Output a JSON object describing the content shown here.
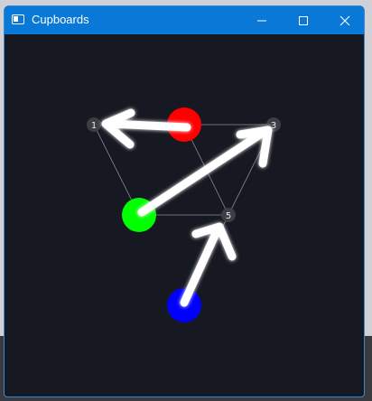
{
  "window": {
    "title": "Cupboards",
    "minimize_icon": "minimize-icon",
    "maximize_icon": "maximize-icon",
    "close_icon": "close-icon"
  },
  "graph": {
    "background": "#171922",
    "edge_color": "#8a8d96",
    "node_color": "#3c3e44",
    "arrow_color": "#ffffff",
    "nodes": [
      {
        "label": "1"
      },
      {
        "label": "3"
      },
      {
        "label": "5"
      }
    ],
    "balls": [
      {
        "color": "#ff0000",
        "name": "red"
      },
      {
        "color": "#00ff00",
        "name": "green"
      },
      {
        "color": "#0000ff",
        "name": "blue"
      }
    ]
  }
}
